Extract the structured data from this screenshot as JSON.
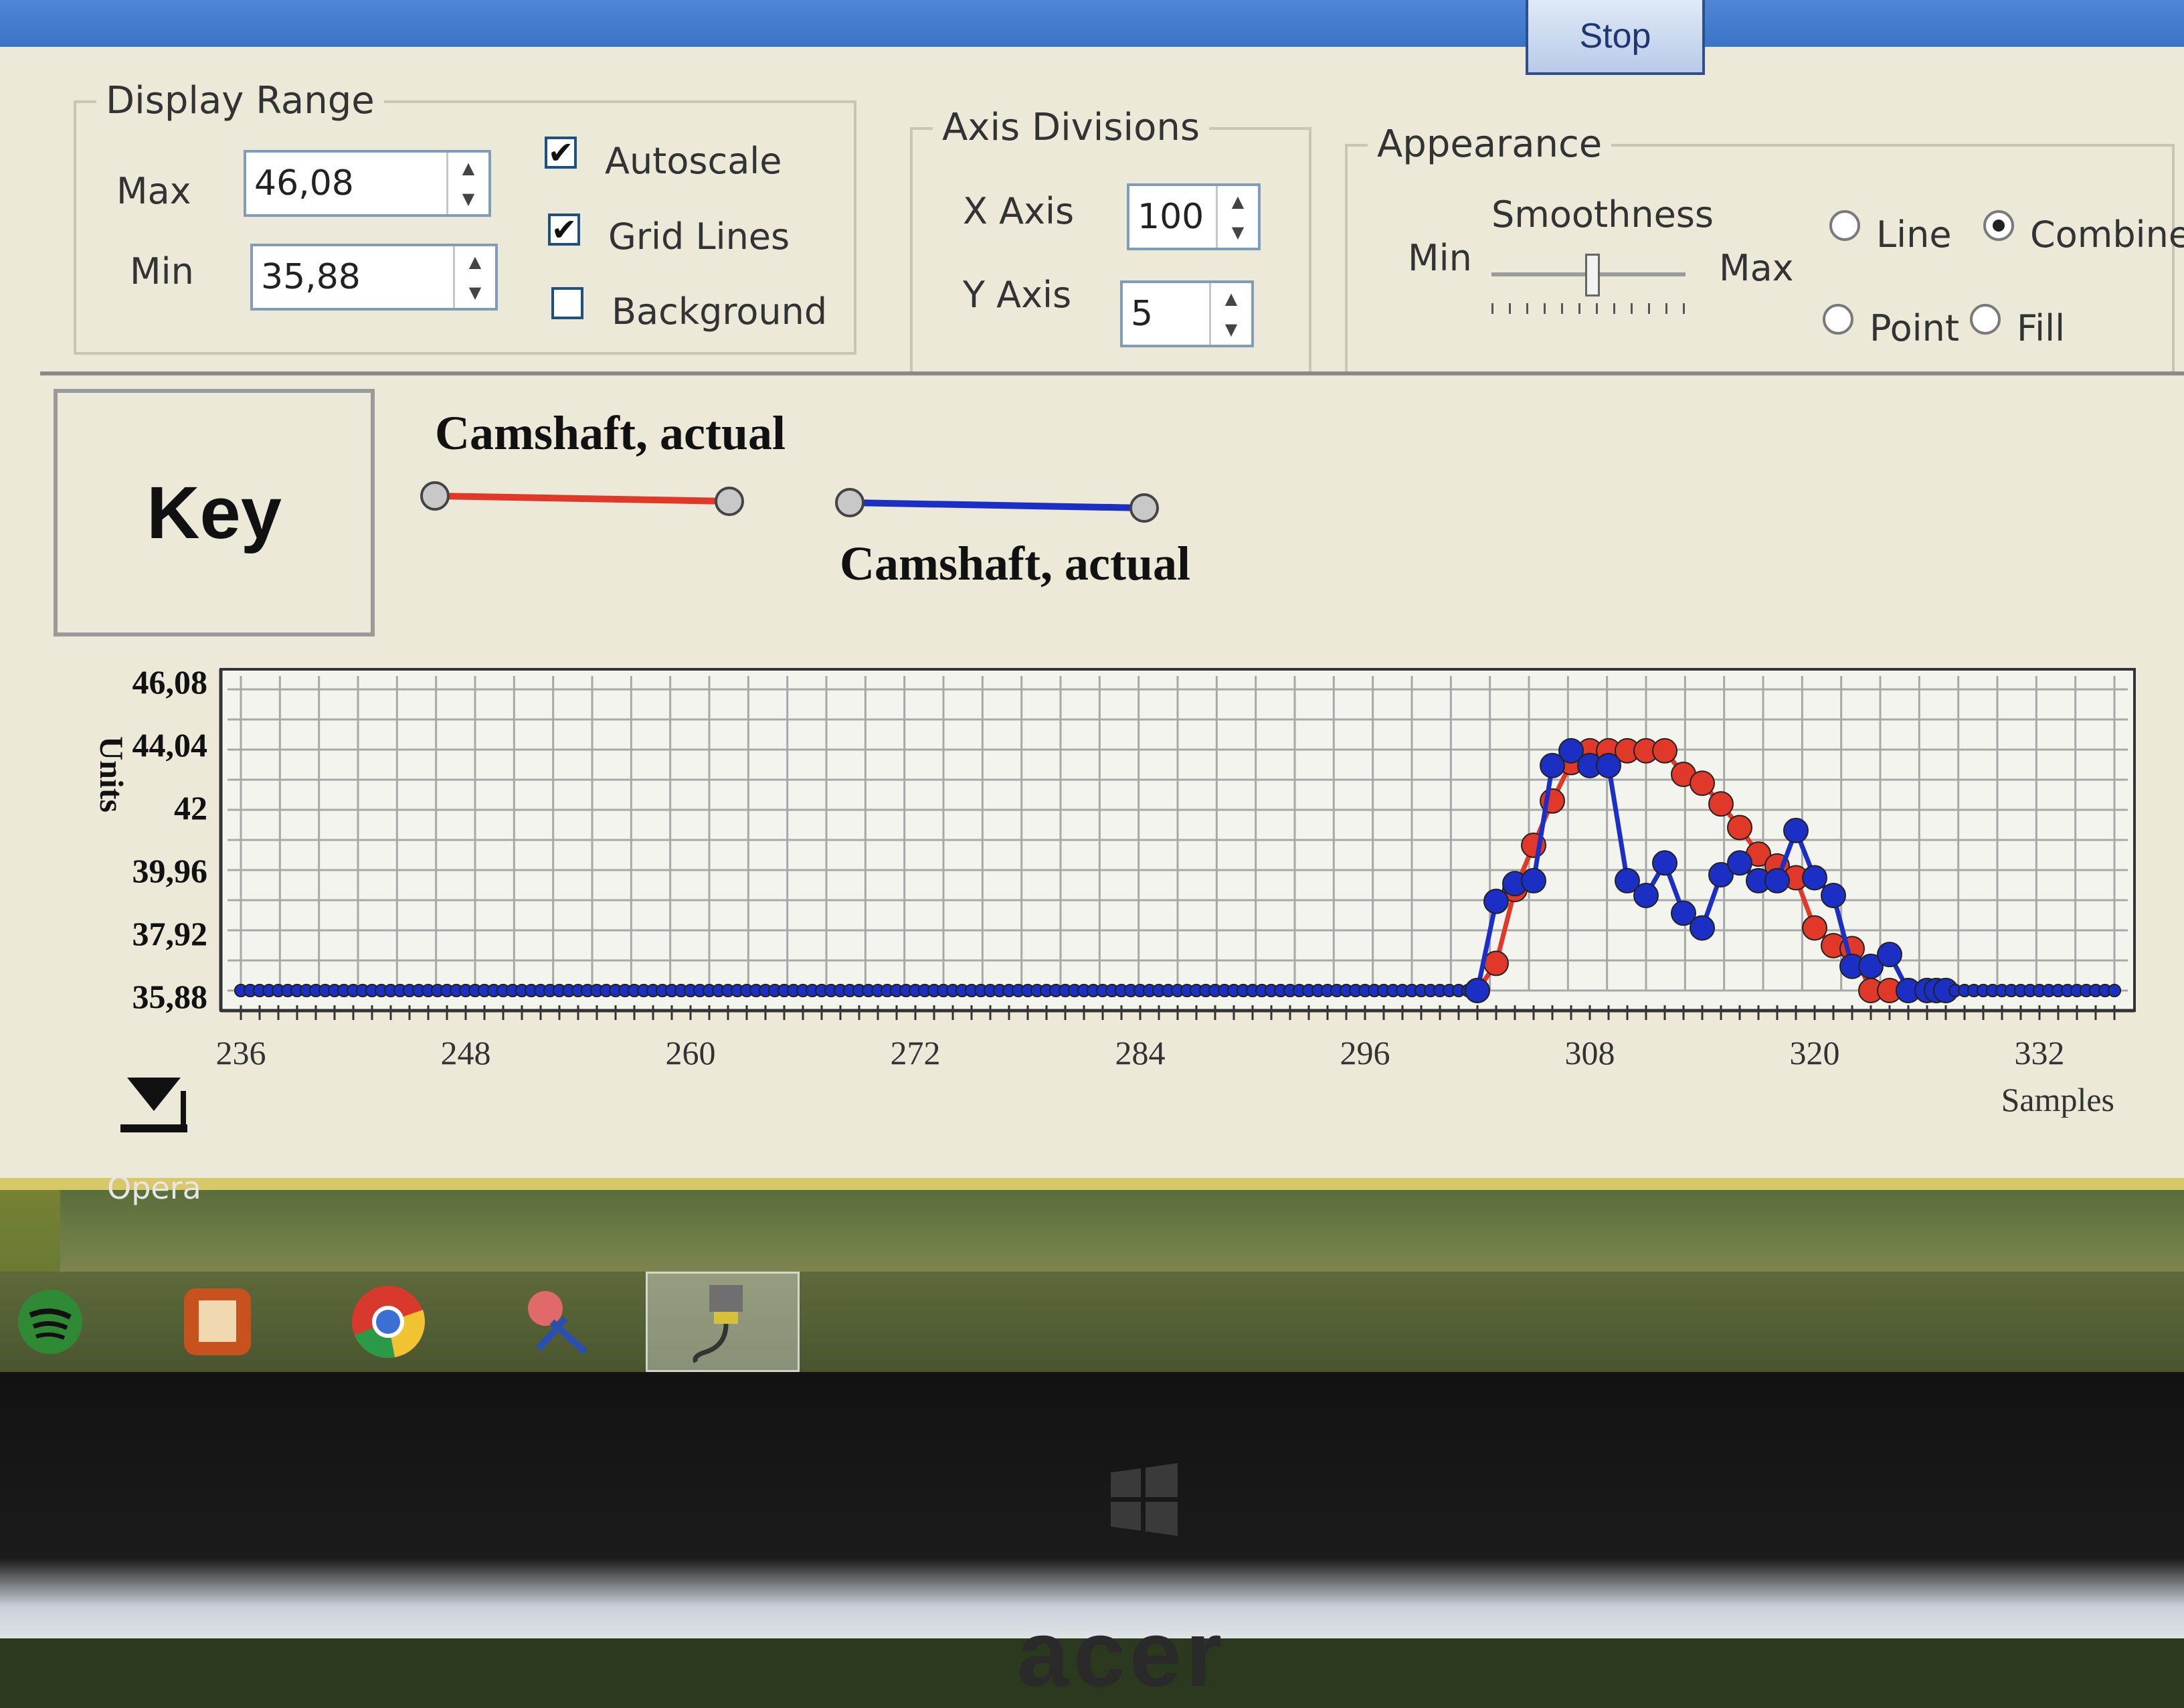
{
  "toolbar": {
    "stop_label": "Stop"
  },
  "display_range": {
    "title": "Display Range",
    "max_label": "Max",
    "min_label": "Min",
    "max_value": "46,08",
    "min_value": "35,88",
    "autoscale_label": "Autoscale",
    "autoscale_checked": true,
    "gridlines_label": "Grid Lines",
    "gridlines_checked": true,
    "background_label": "Background",
    "background_checked": false
  },
  "axis_divisions": {
    "title": "Axis Divisions",
    "x_label": "X Axis",
    "x_value": "100",
    "y_label": "Y Axis",
    "y_value": "5"
  },
  "appearance": {
    "title": "Appearance",
    "smoothness_label": "Smoothness",
    "min_label": "Min",
    "max_label": "Max",
    "options": [
      "Line",
      "Combine",
      "Point",
      "Fill"
    ],
    "selected": "Combine"
  },
  "key": {
    "label": "Key",
    "series_red_label": "Camshaft, actual",
    "series_blue_label": "Camshaft, actual"
  },
  "desktop": {
    "label": "Opera"
  },
  "taskbar": {
    "apps": [
      "spotify-icon",
      "files-icon",
      "chrome-icon",
      "snipping-tool-icon",
      "obd-cable-icon"
    ],
    "active": "obd-cable-icon"
  },
  "device": {
    "brand": "acer"
  },
  "colors": {
    "red_series": "#e0392a",
    "blue_series": "#1c2fc4",
    "grid": "#a8a8a8"
  },
  "chart_data": {
    "type": "line",
    "ylabel": "Units",
    "xlabel": "Samples",
    "ylim": [
      35.88,
      46.08
    ],
    "xlim": [
      236,
      336
    ],
    "y_ticks": [
      "46,08",
      "44,04",
      "42",
      "39,96",
      "37,92",
      "35,88"
    ],
    "x_ticks": [
      "236",
      "248",
      "260",
      "272",
      "284",
      "296",
      "308",
      "320",
      "332"
    ],
    "grid": true,
    "series": [
      {
        "name": "Camshaft, actual",
        "color": "red",
        "x": [
          236,
          302,
          303,
          304,
          305,
          306,
          307,
          308,
          309,
          310,
          311,
          312,
          313,
          314,
          315,
          316,
          317,
          318,
          319,
          320,
          321,
          322,
          323,
          324,
          325,
          326,
          336
        ],
        "y": [
          35.88,
          35.88,
          36.8,
          39.3,
          40.8,
          42.3,
          43.6,
          44.0,
          44.0,
          44.0,
          44.0,
          44.0,
          43.2,
          42.9,
          42.2,
          41.4,
          40.5,
          40.1,
          39.7,
          38.0,
          37.4,
          37.3,
          35.88,
          35.88,
          35.88,
          35.88,
          35.88
        ]
      },
      {
        "name": "Camshaft, actual",
        "color": "blue",
        "x": [
          236,
          302,
          303,
          304,
          305,
          306,
          307,
          308,
          309,
          310,
          311,
          312,
          313,
          314,
          315,
          316,
          317,
          318,
          319,
          320,
          321,
          322,
          323,
          324,
          325,
          326,
          336
        ],
        "y": [
          35.88,
          35.88,
          38.9,
          39.5,
          39.6,
          43.5,
          44.0,
          43.5,
          43.5,
          39.6,
          39.1,
          40.2,
          38.5,
          38.0,
          39.8,
          40.2,
          39.6,
          39.6,
          41.3,
          39.7,
          39.1,
          36.7,
          36.7,
          37.1,
          35.88,
          35.88,
          35.88
        ]
      }
    ]
  }
}
